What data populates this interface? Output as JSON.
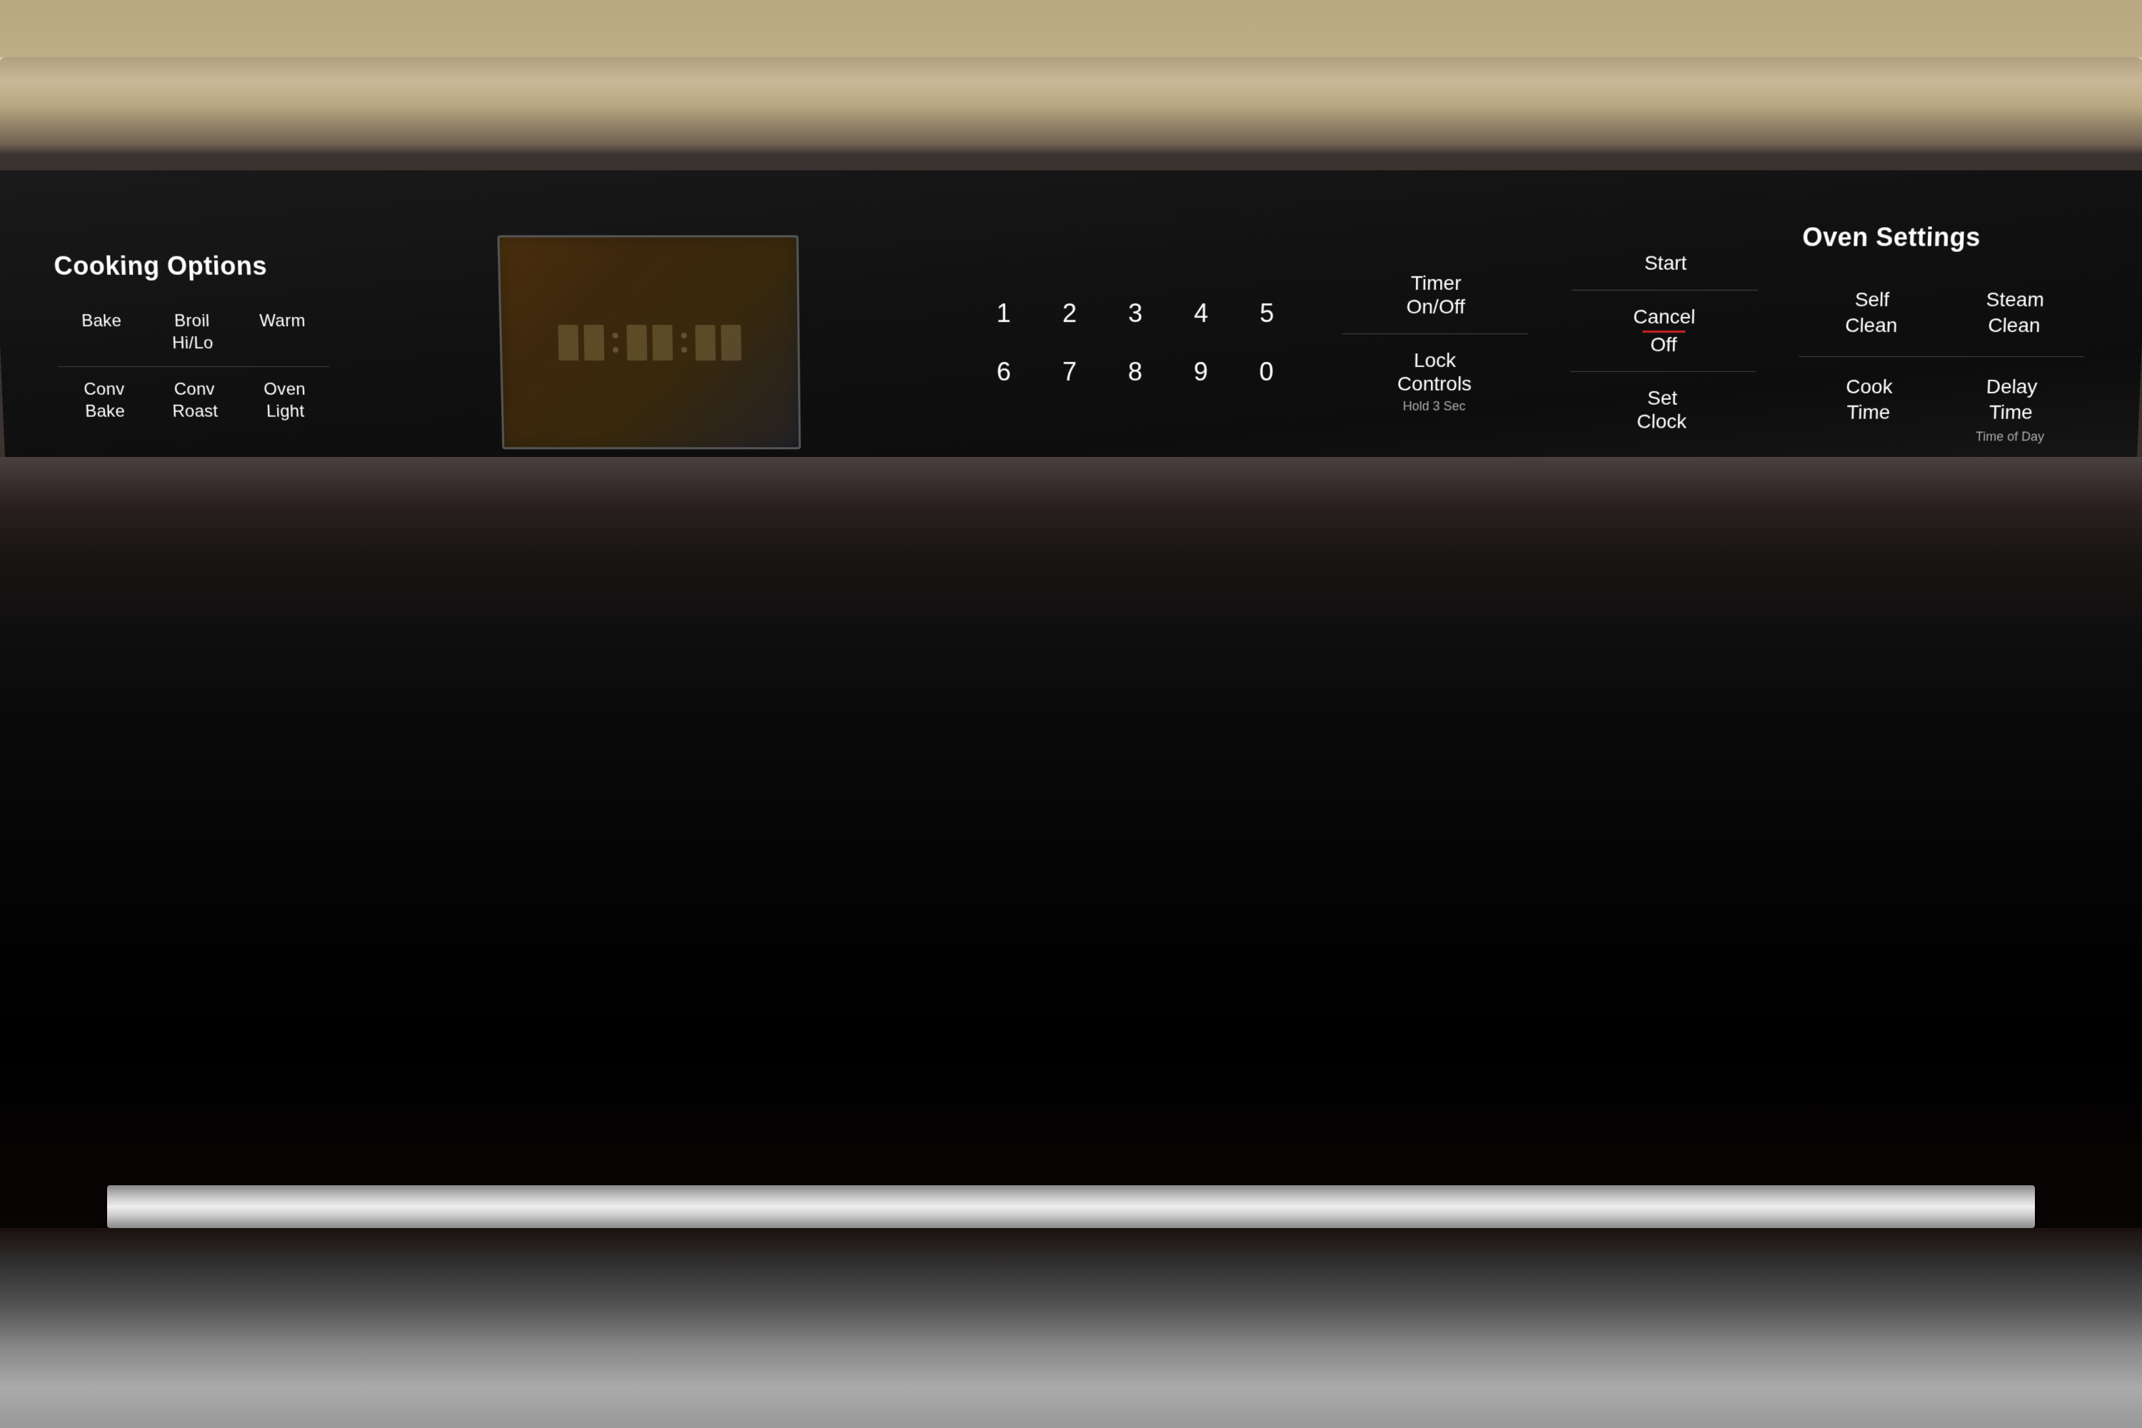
{
  "panel": {
    "background_color": "#111111",
    "trim_color": "#b0a070"
  },
  "cooking_options": {
    "title": "Cooking Options",
    "buttons": [
      {
        "label": "Bake",
        "id": "bake"
      },
      {
        "label": "Broil\nHi/Lo",
        "id": "broil",
        "multiline": "Broil\nHi/Lo",
        "line1": "Broil",
        "line2": "Hi/Lo"
      },
      {
        "label": "Warm",
        "id": "warm"
      },
      {
        "label": "Conv\nBake",
        "id": "conv-bake",
        "line1": "Conv",
        "line2": "Bake"
      },
      {
        "label": "Conv\nRoast",
        "id": "conv-roast",
        "line1": "Conv",
        "line2": "Roast"
      },
      {
        "label": "Oven\nLight",
        "id": "oven-light",
        "line1": "Oven",
        "line2": "Light"
      }
    ]
  },
  "numpad": {
    "keys": [
      "1",
      "2",
      "3",
      "4",
      "5",
      "6",
      "7",
      "8",
      "9",
      "0"
    ]
  },
  "timer": {
    "label": "Timer\nOn/Off",
    "line1": "Timer",
    "line2": "On/Off"
  },
  "lock_controls": {
    "label": "Lock\nControls",
    "line1": "Lock",
    "line2": "Controls",
    "sub_label": "Hold 3 Sec"
  },
  "start_button": {
    "label": "Start"
  },
  "cancel_off_button": {
    "label": "Cancel",
    "label2": "Off",
    "has_red_underline": true
  },
  "set_clock_button": {
    "label": "Set\nClock",
    "line1": "Set",
    "line2": "Clock"
  },
  "oven_settings": {
    "title": "Oven Settings",
    "buttons": [
      {
        "label": "Self\nClean",
        "id": "self-clean",
        "line1": "Self",
        "line2": "Clean"
      },
      {
        "label": "Steam\nClean",
        "id": "steam-clean",
        "line1": "Steam",
        "line2": "Clean"
      },
      {
        "label": "Cook\nTime",
        "id": "cook-time",
        "line1": "Cook",
        "line2": "Time"
      },
      {
        "label": "Delay\nTime",
        "id": "delay-time",
        "line1": "Delay",
        "line2": "Time"
      }
    ],
    "sub_label": "Time of Day"
  }
}
